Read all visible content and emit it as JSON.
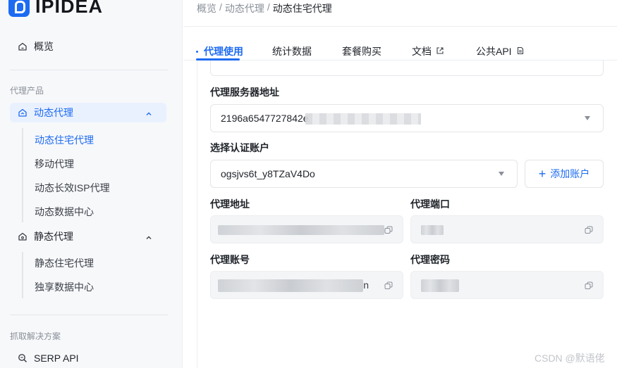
{
  "brand": {
    "name": "IPIDEA"
  },
  "sidebar": {
    "overview": "概览",
    "section_products": "代理产品",
    "dynamic": {
      "label": "动态代理",
      "items": [
        "动态住宅代理",
        "移动代理",
        "动态长效ISP代理",
        "动态数据中心"
      ]
    },
    "static": {
      "label": "静态代理",
      "items": [
        "静态住宅代理",
        "独享数据中心"
      ]
    },
    "section_solutions": "抓取解决方案",
    "serp": "SERP API"
  },
  "breadcrumb": {
    "items": [
      "概览",
      "动态代理"
    ],
    "current": "动态住宅代理",
    "sep": "/"
  },
  "tabs": [
    {
      "label": "代理使用"
    },
    {
      "label": "统计数据"
    },
    {
      "label": "套餐购买"
    },
    {
      "label": "文档"
    },
    {
      "label": "公共API"
    }
  ],
  "form": {
    "server_label": "代理服务器地址",
    "server_value": "2196a6547727842e",
    "account_label": "选择认证账户",
    "account_value": "ogsjvs6t_y8TZaV4Do",
    "add_account": "添加账户",
    "proxy_addr_label": "代理地址",
    "proxy_port_label": "代理端口",
    "proxy_user_label": "代理账号",
    "proxy_user_tail": "n",
    "proxy_pass_label": "代理密码"
  },
  "watermark": "CSDN @默语佬",
  "colors": {
    "accent": "#1d6bf2",
    "sidebar_bg": "#f7f8fa",
    "active_bg": "#eaf1fe"
  }
}
